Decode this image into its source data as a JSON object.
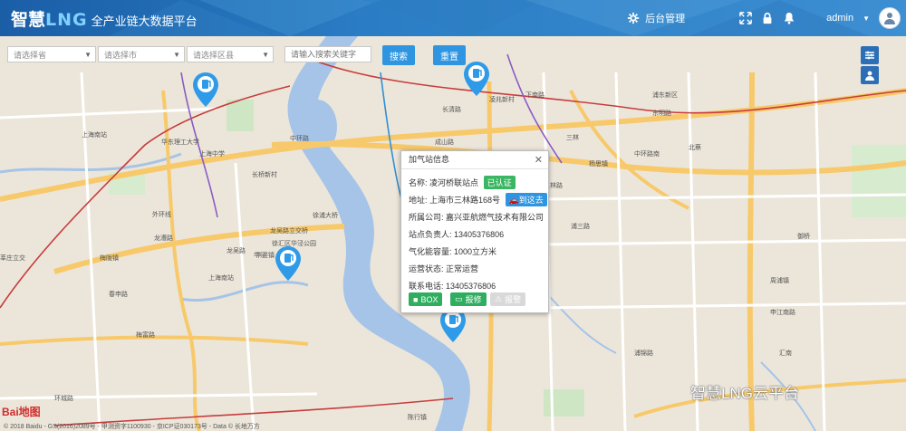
{
  "app": {
    "logo_main": "智慧",
    "logo_lng": "LNG",
    "logo_sub": "全产业链大数据平台"
  },
  "header": {
    "backend_label": "后台管理",
    "user": "admin",
    "icons": [
      "gear-icon",
      "expand-icon",
      "lock-icon",
      "bell-icon",
      "avatar"
    ]
  },
  "filters": {
    "province": "请选择省",
    "city": "请选择市",
    "district": "请选择区县",
    "keyword_placeholder": "请输入搜索关键字",
    "search_label": "搜索",
    "reset_label": "重置"
  },
  "popup": {
    "title": "加气站信息",
    "name_label": "名称:",
    "name_value": "凌河桥联站点",
    "verified_badge": "已认证",
    "address_label": "地址:",
    "address_value": "上海市三林路168号",
    "nav_label": "到这去",
    "company_label": "所属公司:",
    "company_value": "嘉兴亚航燃气技术有限公司",
    "manager_label": "站点负责人:",
    "manager_value": "13405376806",
    "capacity_label": "气化能容量:",
    "capacity_value": "1000立方米",
    "status_label": "运营状态:",
    "status_value": "正常运营",
    "phone_label": "联系电话:",
    "phone_value": "13405376806",
    "btn_box": "BOX",
    "btn_report": "报修",
    "btn_warning": "报警"
  },
  "map": {
    "road_labels": [
      "中环路",
      "龙吴路",
      "龙吴路立交桥",
      "华泾",
      "徐汇区华泾公园",
      "上海南站",
      "龙漕路",
      "华东理工大学",
      "上海中学",
      "长桥新村",
      "三林",
      "杨思镇",
      "中环路南",
      "申江南路",
      "周浦镇",
      "陈行镇",
      "华泾镇",
      "梅陇镇",
      "春申路",
      "莘庄立交",
      "徐浦大桥",
      "外环线",
      "浦东新区",
      "三林路",
      "长清路",
      "下南路",
      "东明路",
      "成山路",
      "凌兆新村",
      "浦三路",
      "北蔡",
      "御桥",
      "上海南站",
      "汇南",
      "浦锦路",
      "梅富路",
      "环城路"
    ]
  },
  "footer": {
    "copyright": "© 2018 Baidu - GS(2016)2089号 - 甲测资字1100930 - 京ICP证030173号 - Data © 长地万方",
    "baidu_logo": "Bai地图",
    "watermark": "智慧LNG云平台"
  },
  "colors": {
    "header_start": "#1a5ea6",
    "header_end": "#3d8fd2",
    "primary_button": "#2f95e0",
    "success_badge": "#3bb662",
    "pin_blue": "#2f9be8",
    "water": "#a5c4e8"
  }
}
